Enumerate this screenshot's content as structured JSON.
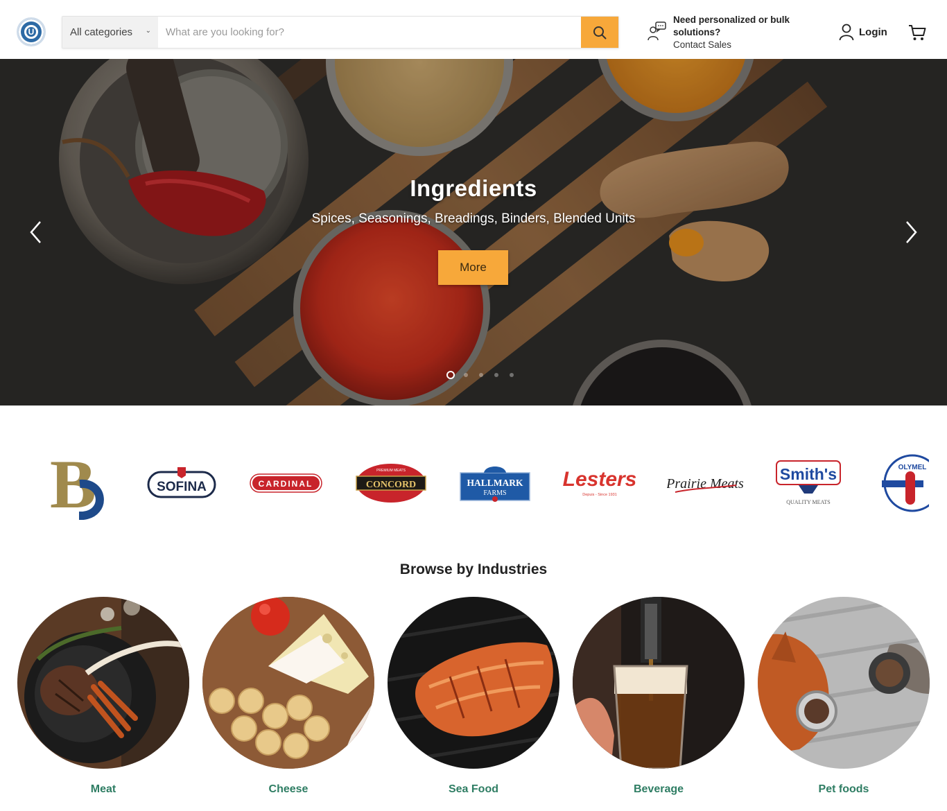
{
  "header": {
    "logo_letter": "U",
    "category_select": "All categories",
    "search_placeholder": "What are you looking for?",
    "contact_title": "Need personalized or bulk solutions?",
    "contact_link": "Contact Sales",
    "login_label": "Login"
  },
  "hero": {
    "title": "Ingredients",
    "subtitle": "Spices, Seasonings, Breadings, Binders, Blended Units",
    "button_label": "More",
    "slide_count": 5,
    "active_slide": 1
  },
  "brands": {
    "items": [
      {
        "name": "B",
        "kind": "monogram"
      },
      {
        "name": "SOFINA"
      },
      {
        "name": "CARDINAL"
      },
      {
        "name": "CONCORD",
        "tagline": "PREMIUM MEATS"
      },
      {
        "name": "HALLMARK",
        "sub": "FARMS"
      },
      {
        "name": "Lesters",
        "tagline": "Depuis - Since 1931"
      },
      {
        "name": "Prairie Meats"
      },
      {
        "name": "Smith's",
        "tagline": "QUALITY MEATS"
      },
      {
        "name": "OLYMEL"
      }
    ]
  },
  "industries": {
    "title": "Browse by Industries",
    "items": [
      {
        "label": "Meat"
      },
      {
        "label": "Cheese"
      },
      {
        "label": "Sea Food"
      },
      {
        "label": "Beverage"
      },
      {
        "label": "Pet foods"
      }
    ]
  },
  "colors": {
    "accent": "#f7a83a",
    "industry_label": "#2e7d63",
    "logo_blue": "#2d6aa5"
  }
}
